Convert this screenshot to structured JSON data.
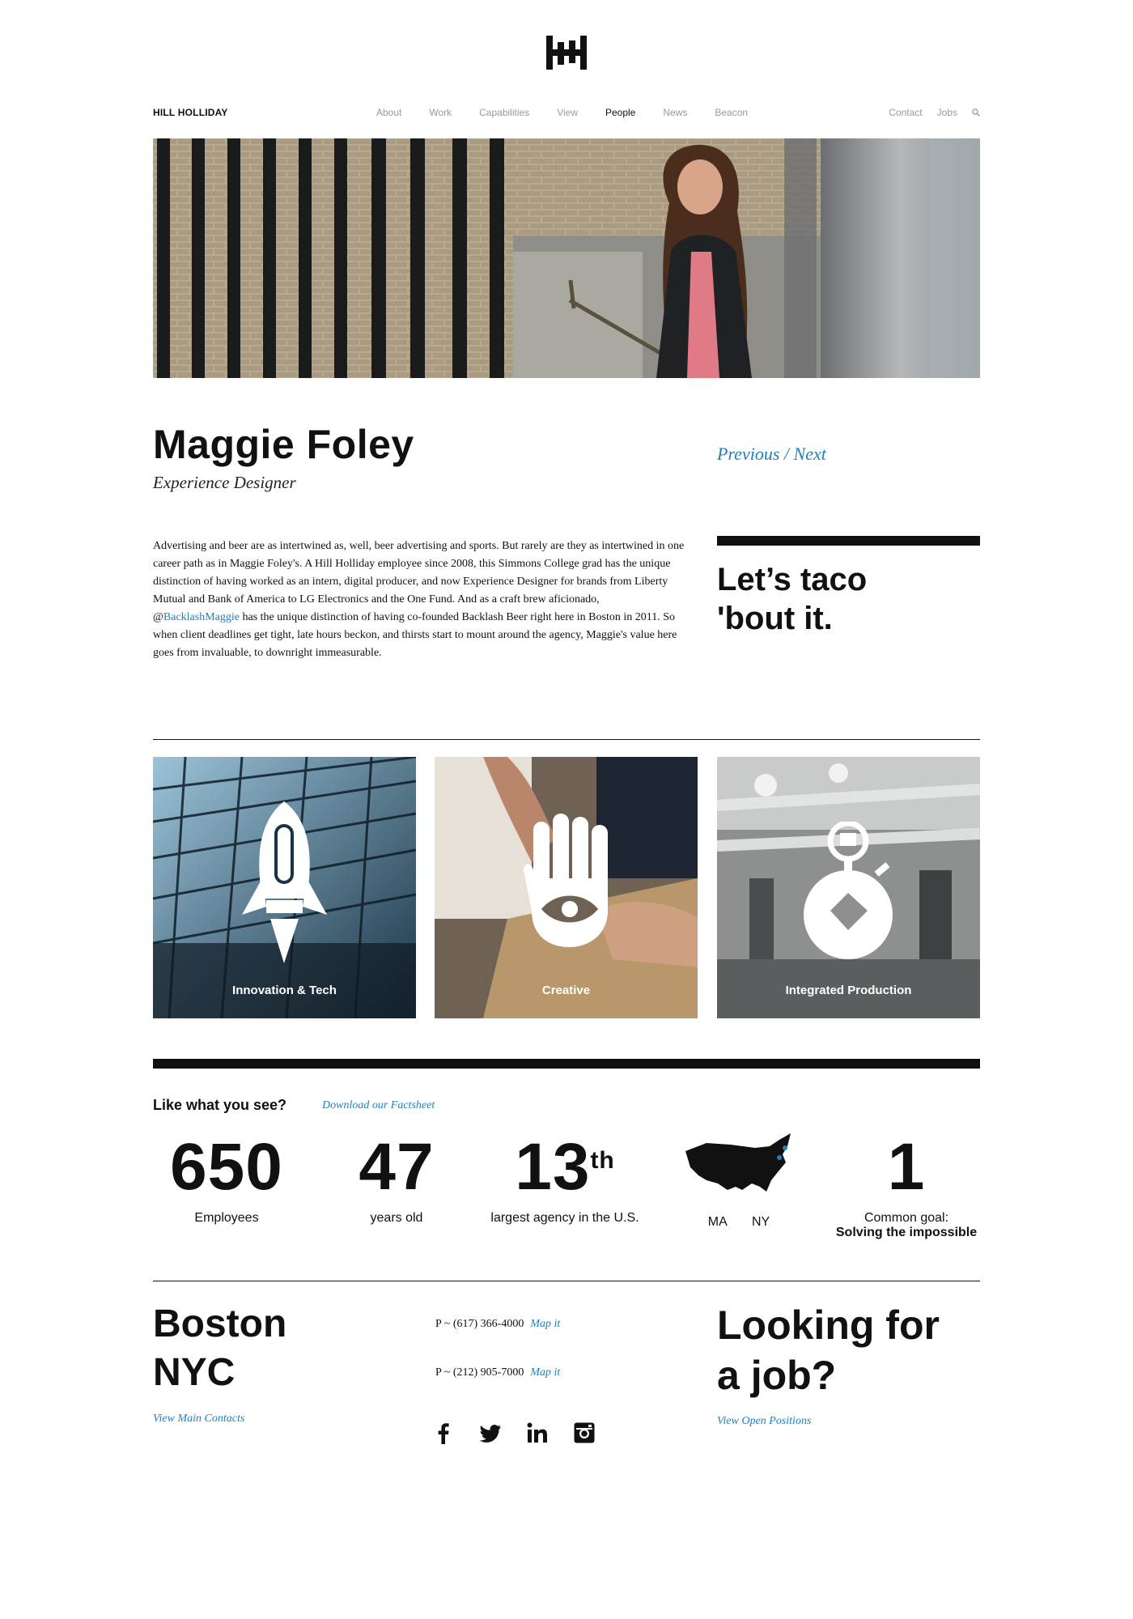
{
  "brand": {
    "name": "HILL HOLLIDAY"
  },
  "nav": {
    "center": [
      "About",
      "Work",
      "Capabilities",
      "View",
      "People",
      "News",
      "Beacon"
    ],
    "active": "People",
    "right": [
      "Contact",
      "Jobs"
    ],
    "search_icon": "search-icon"
  },
  "profile": {
    "name": "Maggie Foley",
    "title": "Experience Designer",
    "previous": "Previous",
    "separator": "/",
    "next": "Next",
    "bio_before": "Advertising and beer are as intertwined as, well, beer advertising and sports. But rarely are they as intertwined in one career path as in Maggie Foley's. A Hill Holliday employee since 2008, this Simmons College grad has the unique distinction of having worked as an intern, digital producer, and now Experience Designer for brands from Liberty Mutual and Bank of America to LG Electronics and the One Fund. And as a craft brew aficionado, @",
    "bio_link": "BacklashMaggie",
    "bio_after": " has the unique distinction of having co-founded Backlash Beer right here in Boston in 2011. So when client deadlines get tight, late hours beckon, and thirsts start to mount around the agency, Maggie's value here goes from invaluable, to downright immeasurable.",
    "quote_line1": "Let’s taco",
    "quote_line2": "'bout it."
  },
  "tiles": [
    {
      "label": "Innovation & Tech",
      "icon": "rocket-icon"
    },
    {
      "label": "Creative",
      "icon": "hand-eye-icon"
    },
    {
      "label": "Integrated Production",
      "icon": "stopwatch-icon"
    }
  ],
  "stats": {
    "heading": "Like what you see?",
    "factsheet": "Download our Factsheet",
    "items": [
      {
        "value": "650",
        "label": "Employees"
      },
      {
        "value": "47",
        "label": "years old"
      },
      {
        "value": "13",
        "sup": "th",
        "label": "largest agency in the U.S."
      },
      {
        "map_icon": "usa-map-icon",
        "label_a": "MA",
        "label_b": "NY"
      },
      {
        "value": "1",
        "label": "Common goal:",
        "label_bold": "Solving the impossible"
      }
    ]
  },
  "footer": {
    "city1": "Boston",
    "city2": "NYC",
    "contacts_link": "View Main Contacts",
    "phone1": "P ~ (617) 366-4000",
    "phone2": "P ~ (212) 905-7000",
    "map_link": "Map it",
    "social": [
      "facebook-icon",
      "twitter-icon",
      "linkedin-icon",
      "instagram-icon"
    ],
    "job_line1": "Looking for",
    "job_line2": "a job?",
    "positions_link": "View Open Positions"
  },
  "colors": {
    "accent": "#1f7fbf",
    "text": "#111111",
    "nav_inactive": "#9a9a9a"
  }
}
